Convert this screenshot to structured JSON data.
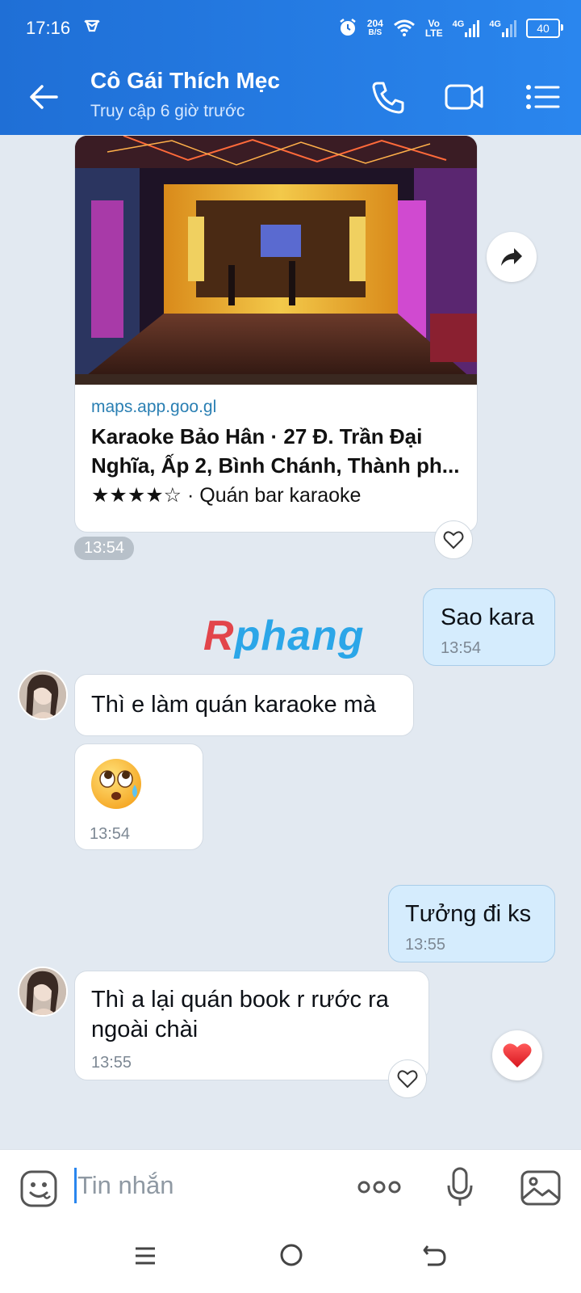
{
  "status_bar": {
    "time": "17:16",
    "notification_icon": "mail-notification-icon",
    "speed_value": "204",
    "speed_unit": "B/S",
    "volte_top": "Vo",
    "volte_bottom": "LTE",
    "network1": "4G",
    "network2": "4G",
    "battery": "40"
  },
  "header": {
    "contact_name": "Cô Gái Thích Mẹc",
    "contact_status": "Truy cập 6 giờ trước",
    "icons": [
      "back-arrow-icon",
      "phone-icon",
      "video-camera-icon",
      "list-menu-icon"
    ]
  },
  "link_card": {
    "domain": "maps.app.goo.gl",
    "title": "Karaoke Bảo Hân · 27 Đ. Trần Đại Nghĩa, Ấp 2, Bình Chánh, Thành ph...",
    "subtitle": "★★★★☆ · Quán bar karaoke",
    "rating": 4,
    "time": "13:54"
  },
  "messages": [
    {
      "direction": "out",
      "text": "Sao kara",
      "time": "13:54"
    },
    {
      "direction": "in",
      "text": "Thì e làm quán karaoke mà",
      "time": ""
    },
    {
      "direction": "in",
      "emoji": "🥺",
      "time": "13:54"
    },
    {
      "direction": "out",
      "text": "Tưởng đi ks",
      "time": "13:55"
    },
    {
      "direction": "in",
      "text": "Thì a lại quán book r rước ra ngoài chài",
      "time": "13:55"
    }
  ],
  "watermark": {
    "first": "R",
    "rest": "phang"
  },
  "composer": {
    "placeholder": "Tin nhắn",
    "value": ""
  },
  "colors": {
    "header_start": "#1f6fd6",
    "header_end": "#2a86ee",
    "chat_bg": "#e2e9f1",
    "outgoing_bubble": "#d5ecfd",
    "incoming_bubble": "#ffffff",
    "heart": "#e8242f"
  }
}
